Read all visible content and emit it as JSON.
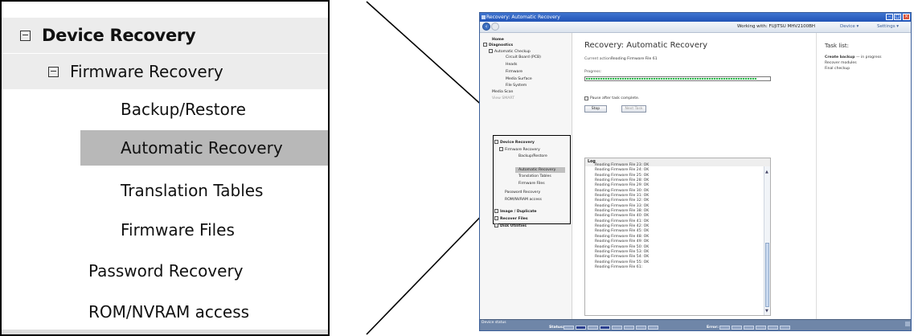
{
  "zoom": {
    "device_recovery": "Device Recovery",
    "firmware_recovery": "Firmware Recovery",
    "backup_restore": "Backup/Restore",
    "automatic_recovery": "Automatic Recovery",
    "translation_tables": "Translation Tables",
    "firmware_files": "Firmware Files",
    "password_recovery": "Password Recovery",
    "rom_nvram": "ROM/NVRAM access"
  },
  "window": {
    "title": "Recovery: Automatic Recovery",
    "working_with": "Working with: FUJITSU MHV2100BH",
    "device_menu": "Device ▾",
    "settings_menu": "Settings ▾"
  },
  "sidebar": {
    "home": "Home",
    "diagnostics": "Diagnostics",
    "automatic_checkup": "Automatic Checkup",
    "circuit_board": "Circuit Board (PCB)",
    "heads": "Heads",
    "firmware": "Firmware",
    "media_surface": "Media Surface",
    "file_system": "File System",
    "media_scan": "Media Scan",
    "view_smart": "View SMART",
    "device_recovery": "Device Recovery",
    "firmware_recovery": "Firmware Recovery",
    "backup_restore": "Backup/Restore",
    "automatic_recovery": "Automatic Recovery",
    "translation_tables": "Translation Tables",
    "firmware_files": "Firmware Files",
    "password_recovery": "Password Recovery",
    "rom_nvram": "ROM/NVRAM access",
    "image_duplicate": "Image / Duplicate",
    "recover_files": "Recover Files",
    "disk_utilities": "Disk Utilities"
  },
  "main": {
    "title": "Recovery: Automatic Recovery",
    "current_action_label": "Current action:",
    "current_action_value": "Reading Firmware File 61",
    "progress_label": "Progress:",
    "progress_fraction": 0.93,
    "pause_label": "Pause after task complete.",
    "pause_checked": false,
    "stop_button": "Stop",
    "next_button": "Next Task",
    "log_title": "Log",
    "log_lines": [
      "Reading Firmware File 23: OK",
      "Reading Firmware File 24: OK",
      "Reading Firmware File 25: OK",
      "Reading Firmware File 28: OK",
      "Reading Firmware File 29: OK",
      "Reading Firmware File 30: OK",
      "Reading Firmware File 31: OK",
      "Reading Firmware File 32: OK",
      "Reading Firmware File 33: OK",
      "Reading Firmware File 38: OK",
      "Reading Firmware File 40: OK",
      "Reading Firmware File 41: OK",
      "Reading Firmware File 42: OK",
      "Reading Firmware File 45: OK",
      "Reading Firmware File 48: OK",
      "Reading Firmware File 49: OK",
      "Reading Firmware File 50: OK",
      "Reading Firmware File 53: OK",
      "Reading Firmware File 54: OK",
      "Reading Firmware File 55: OK",
      "Reading Firmware File 61:"
    ]
  },
  "tasklist": {
    "title": "Task list:",
    "items": [
      {
        "label": "Create backup",
        "status": "— in progress"
      },
      {
        "label": "Recover modules",
        "status": ""
      },
      {
        "label": "Final checkup",
        "status": ""
      }
    ]
  },
  "statusbar": {
    "device_status": "Device status",
    "status_label": "Status:",
    "error_label": "Error:",
    "status_cells": [
      "BSY",
      "DRD",
      "DWF",
      "DSC",
      "DRQ",
      "CRR",
      "IDX",
      "ERR"
    ],
    "status_active": [
      "DRD",
      "DSC"
    ],
    "error_cells": [
      "BBK",
      "UNC",
      "INF",
      "ABR",
      "T0N",
      "AMN"
    ]
  },
  "icons": {
    "collapse": "minus-box-icon",
    "back": "back-arrow-icon",
    "forward": "forward-arrow-icon",
    "close": "close-icon",
    "minimize": "minimize-icon",
    "maximize": "maximize-icon"
  }
}
